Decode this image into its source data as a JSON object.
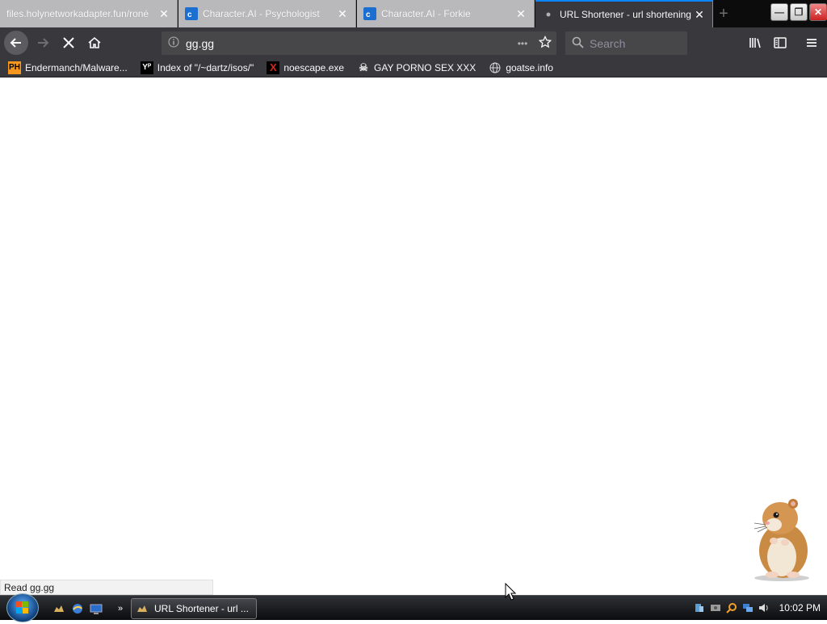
{
  "tabs": [
    {
      "title": "files.holynetworkadapter.fun/roné",
      "active": false
    },
    {
      "title": "Character.AI - Psychologist",
      "active": false
    },
    {
      "title": "Character.AI - Forkie",
      "active": false
    },
    {
      "title": "URL Shortener - url shortening",
      "active": true
    }
  ],
  "tab_close_glyph": "✕",
  "new_tab_glyph": "+",
  "window_buttons": {
    "minimize": "—",
    "restore": "❐",
    "close": "✕"
  },
  "navbar": {
    "url": "gg.gg",
    "search_placeholder": "Search",
    "more_glyph": "•••"
  },
  "bookmarks": [
    {
      "label": "Endermanch/Malware...",
      "icon": "ph-logo-icon",
      "badge": "PH",
      "color": "#f7971d"
    },
    {
      "label": "Index of \"/~dartz/isos/\"",
      "icon": "yp-logo-icon",
      "badge": "Yᴾ",
      "color": "#000000"
    },
    {
      "label": "noescape.exe",
      "icon": "x-logo-icon",
      "badge": "X",
      "color": "#d9251c"
    },
    {
      "label": "GAY PORNO SEX XXX",
      "icon": "skull-icon",
      "badge": "☠",
      "color": "#cccccc"
    },
    {
      "label": "goatse.info",
      "icon": "globe-icon",
      "badge": "◎",
      "color": "#cccccc"
    }
  ],
  "status_text": "Read gg.gg",
  "taskbar": {
    "window_label": "URL Shortener - url ...",
    "quicklaunch_more": "»",
    "clock": "10:02 PM"
  },
  "colors": {
    "accent": "#0a84ff",
    "toolbar": "#38383d"
  }
}
